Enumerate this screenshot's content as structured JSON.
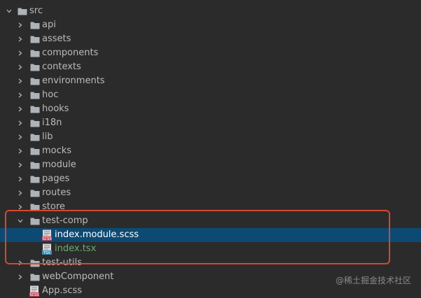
{
  "tree": {
    "root": {
      "label": "src",
      "expanded": true
    },
    "folders_before": [
      {
        "label": "api"
      },
      {
        "label": "assets"
      },
      {
        "label": "components"
      },
      {
        "label": "contexts"
      },
      {
        "label": "environments"
      },
      {
        "label": "hoc"
      },
      {
        "label": "hooks"
      },
      {
        "label": "i18n"
      },
      {
        "label": "lib"
      },
      {
        "label": "mocks"
      },
      {
        "label": "module"
      },
      {
        "label": "pages"
      },
      {
        "label": "routes"
      },
      {
        "label": "store"
      }
    ],
    "expanded_folder": {
      "label": "test-comp",
      "children": [
        {
          "label": "index.module.scss",
          "icon": "scss-file-icon",
          "selected": true
        },
        {
          "label": "index.tsx",
          "icon": "tsx-file-icon",
          "selected": false
        }
      ]
    },
    "folders_after": [
      {
        "label": "test-utils"
      },
      {
        "label": "webComponent"
      }
    ],
    "files_after": [
      {
        "label": "App.scss",
        "icon": "scss-file-icon"
      }
    ]
  },
  "colors": {
    "background": "#2b2b2b",
    "selection": "#0d4a73",
    "highlight_border": "#d6482f",
    "folder_icon": "#aeb3b8",
    "text": "#bbbbbb",
    "tsx_text": "#6aab73"
  },
  "watermark": "@稀土掘金技术社区"
}
